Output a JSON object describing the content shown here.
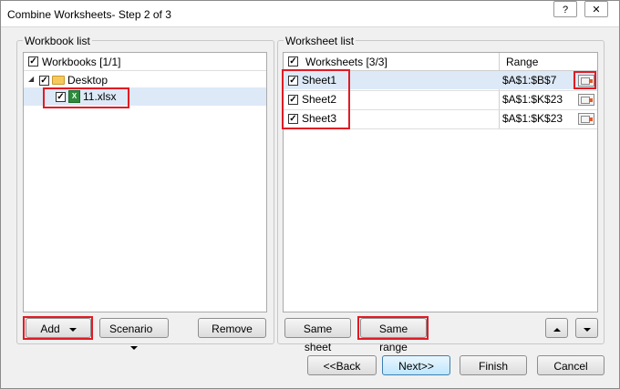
{
  "window": {
    "title": "Combine Worksheets- Step 2 of 3",
    "help_label": "?",
    "close_label": "✕"
  },
  "workbook_group": {
    "label": "Workbook list",
    "header": "Workbooks [1/1]",
    "folder": "Desktop",
    "file": "11.xlsx",
    "expand_glyph": "◢"
  },
  "worksheet_group": {
    "label": "Worksheet list",
    "col_sheets": "Worksheets [3/3]",
    "col_range": "Range",
    "rows": [
      {
        "name": "Sheet1",
        "range": "$A$1:$B$7"
      },
      {
        "name": "Sheet2",
        "range": "$A$1:$K$23"
      },
      {
        "name": "Sheet3",
        "range": "$A$1:$K$23"
      }
    ]
  },
  "left_buttons": {
    "add": "Add",
    "scenario": "Scenario",
    "remove": "Remove"
  },
  "right_buttons": {
    "same_sheet": "Same sheet",
    "same_range": "Same range"
  },
  "footer": {
    "back": "<<Back",
    "next": "Next>>",
    "finish": "Finish",
    "cancel": "Cancel"
  }
}
